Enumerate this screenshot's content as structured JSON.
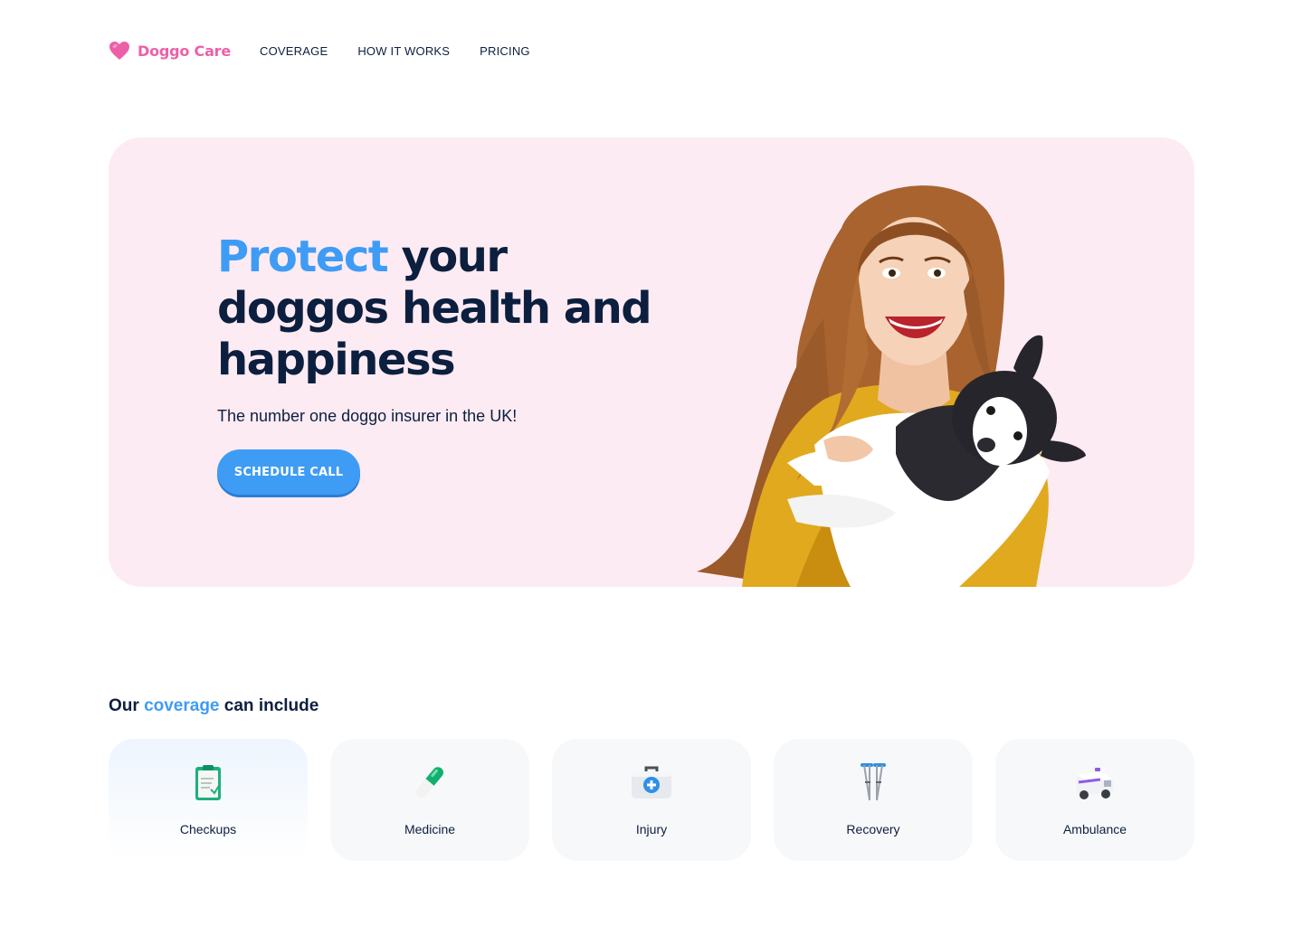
{
  "header": {
    "brand": "Doggo Care",
    "logo_icon": "heart-icon",
    "nav": [
      {
        "label": "COVERAGE"
      },
      {
        "label": "HOW IT WORKS"
      },
      {
        "label": "PRICING"
      }
    ]
  },
  "hero": {
    "title_accent": "Protect",
    "title_rest": " your doggos health and happiness",
    "subtitle": "The number one doggo insurer in the UK!",
    "cta_label": "SCHEDULE CALL",
    "photo": "smiling-woman-holding-boston-terrier"
  },
  "coverage": {
    "heading_before": "Our ",
    "heading_accent": "coverage",
    "heading_after": " can include",
    "items": [
      {
        "label": "Checkups",
        "icon": "clipboard-icon"
      },
      {
        "label": "Medicine",
        "icon": "pill-icon"
      },
      {
        "label": "Injury",
        "icon": "first-aid-kit-icon"
      },
      {
        "label": "Recovery",
        "icon": "crutches-icon"
      },
      {
        "label": "Ambulance",
        "icon": "ambulance-icon"
      }
    ]
  },
  "colors": {
    "brand_pink": "#ee5fa9",
    "accent_blue": "#3f9cf5",
    "navy_text": "#0c1f3f",
    "hero_bg": "#fdebf3",
    "card_bg": "#f7f8fa"
  }
}
